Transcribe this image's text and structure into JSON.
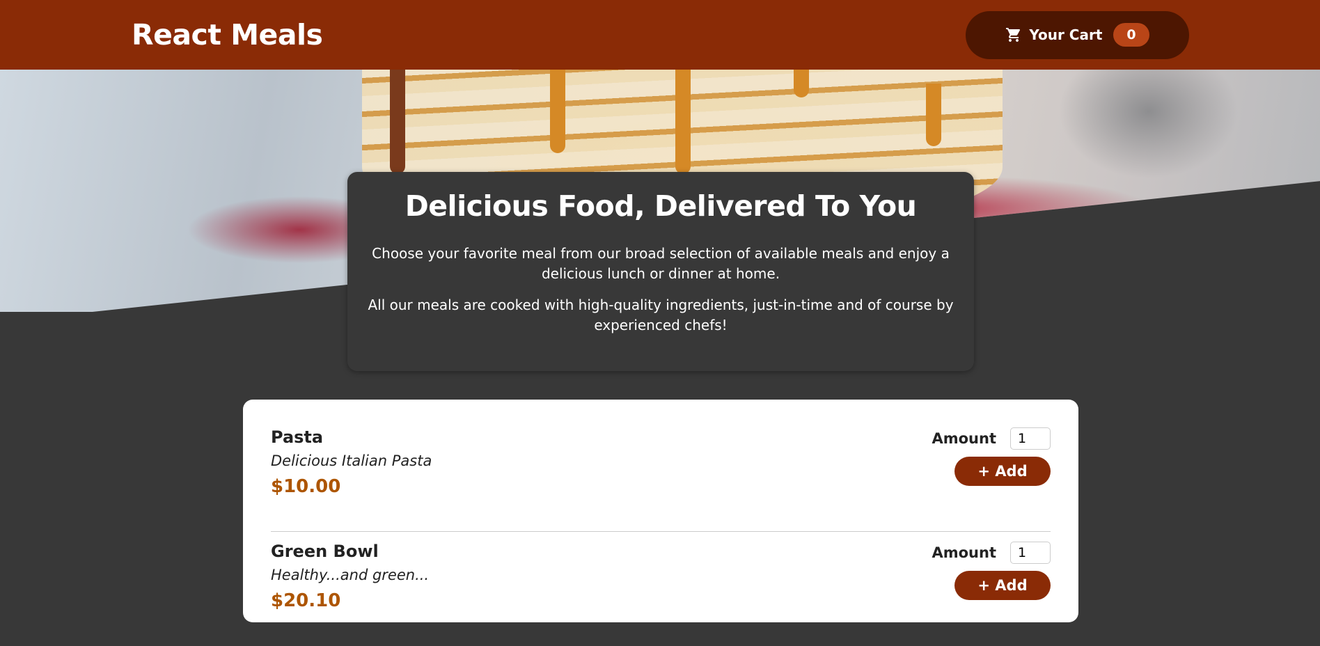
{
  "header": {
    "title": "React Meals",
    "cart_label": "Your Cart",
    "cart_count": "0"
  },
  "hero": {
    "image": "pancakes-with-caramel-syrup"
  },
  "summary": {
    "heading": "Delicious Food, Delivered To You",
    "paragraph1": "Choose your favorite meal from our broad selection of available meals and enjoy a delicious lunch or dinner at home.",
    "paragraph2": "All our meals are cooked with high-quality ingredients, just-in-time and of course by experienced chefs!"
  },
  "meals": [
    {
      "name": "Pasta",
      "description": "Delicious Italian Pasta",
      "price": "$10.00",
      "amount_label": "Amount",
      "amount_value": "1",
      "add_label": "+ Add"
    },
    {
      "name": "Green Bowl",
      "description": "Healthy...and green...",
      "price": "$20.10",
      "amount_label": "Amount",
      "amount_value": "1",
      "add_label": "+ Add"
    }
  ],
  "colors": {
    "header": "#8a2b06",
    "cart_button": "#4d1601",
    "badge": "#b94517",
    "price": "#ad5502",
    "background": "#383838"
  }
}
